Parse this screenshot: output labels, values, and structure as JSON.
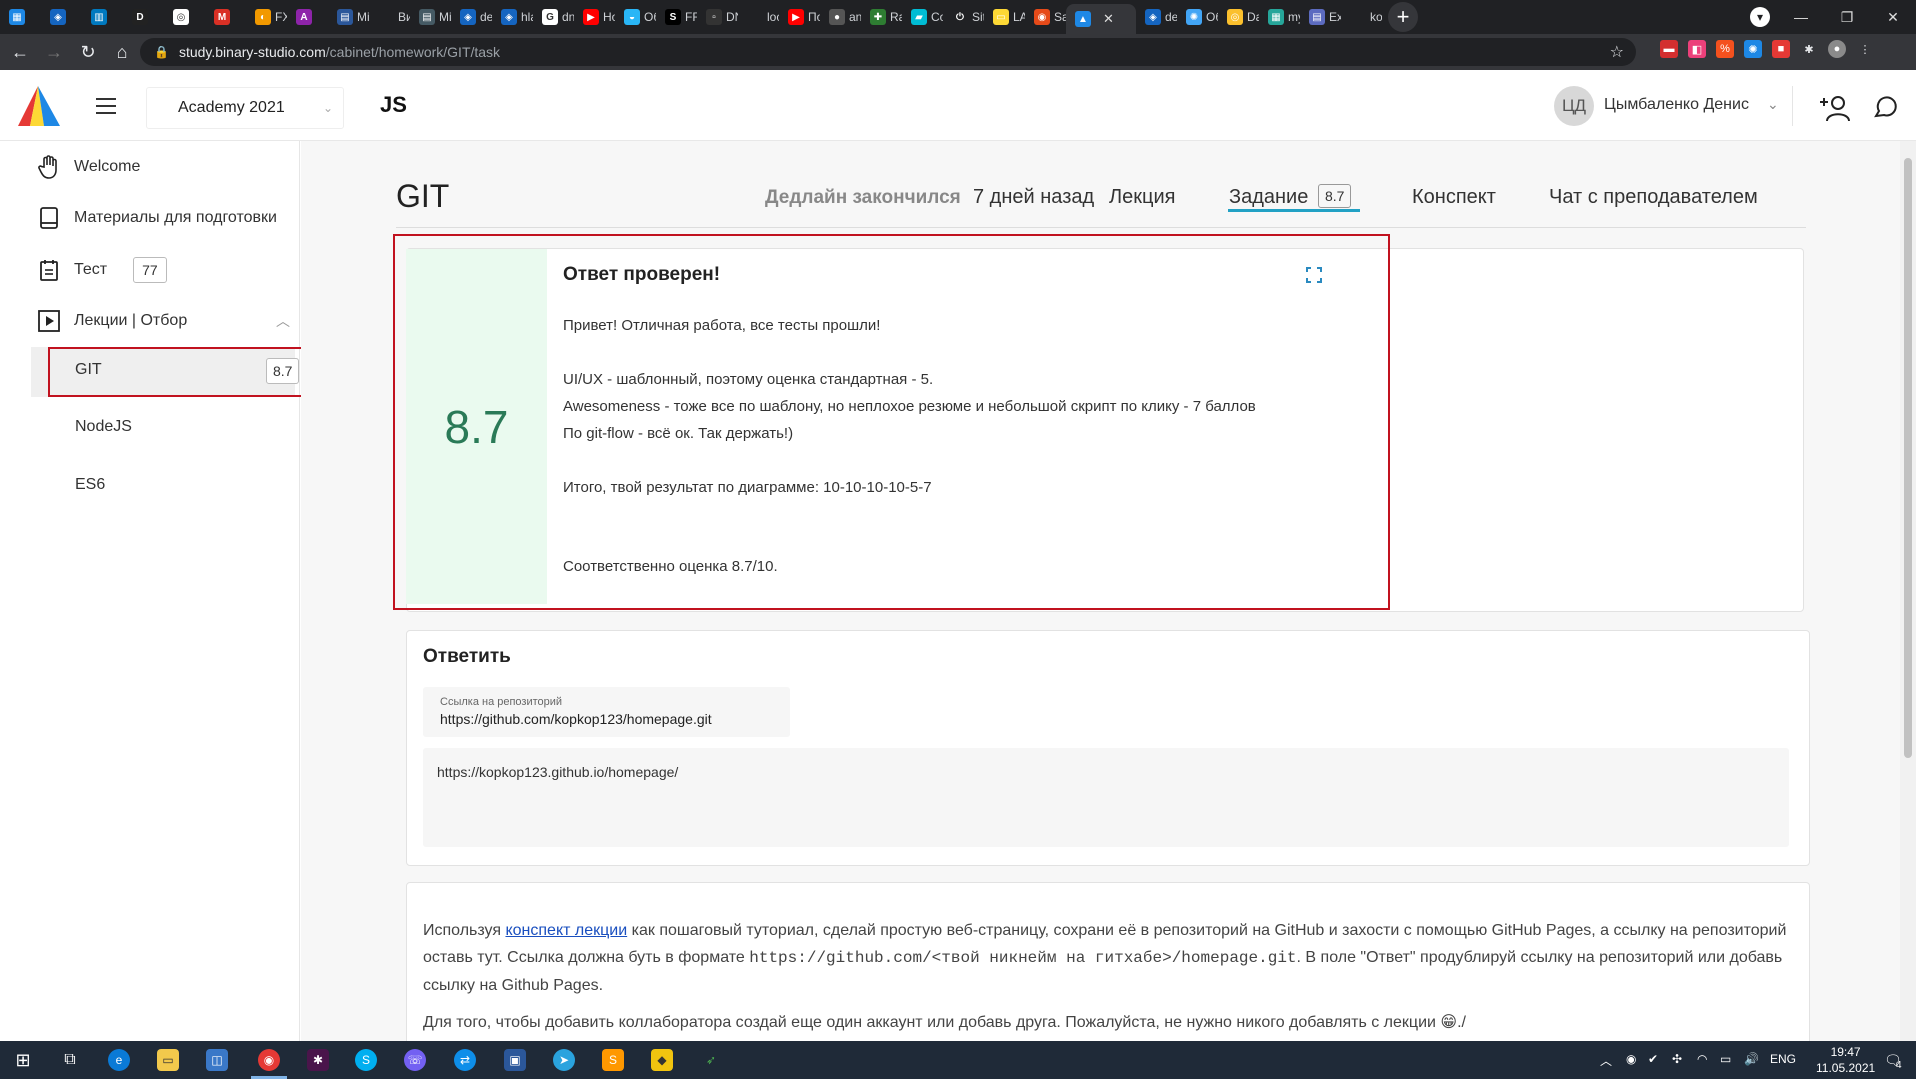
{
  "browser": {
    "tabs": [
      {
        "label": "",
        "color": "#1e88e5",
        "glyph": "▦"
      },
      {
        "label": "",
        "color": "#1565c0",
        "glyph": "◈"
      },
      {
        "label": "",
        "color": "#0079bf",
        "glyph": "▥"
      },
      {
        "label": "",
        "color": "#222222",
        "glyph": "D"
      },
      {
        "label": "",
        "color": "#ffffff",
        "glyph": "◎"
      },
      {
        "label": "",
        "color": "#d93025",
        "glyph": "M"
      },
      {
        "label": "FX",
        "color": "#f29900",
        "glyph": "◐"
      },
      {
        "label": "",
        "color": "#8e24aa",
        "glyph": "A"
      },
      {
        "label": "Mi",
        "color": "#2b579a",
        "glyph": "▤"
      },
      {
        "label": "Ви",
        "color": "#202124",
        "glyph": ""
      },
      {
        "label": "Mi",
        "color": "#455a64",
        "glyph": "▤"
      },
      {
        "label": "de",
        "color": "#1565c0",
        "glyph": "◈"
      },
      {
        "label": "hla",
        "color": "#1565c0",
        "glyph": "◈"
      },
      {
        "label": "dn",
        "color": "#ffffff",
        "glyph": "G"
      },
      {
        "label": "Ho",
        "color": "#ff0000",
        "glyph": "▶"
      },
      {
        "label": "Об",
        "color": "#29b6f6",
        "glyph": "◒"
      },
      {
        "label": "FR",
        "color": "#000000",
        "glyph": "S"
      },
      {
        "label": "DN",
        "color": "#333333",
        "glyph": "▫"
      },
      {
        "label": "loc",
        "color": "#202124",
        "glyph": ""
      },
      {
        "label": "По",
        "color": "#ff0000",
        "glyph": "▶"
      },
      {
        "label": "an",
        "color": "#555555",
        "glyph": "●"
      },
      {
        "label": "Ra",
        "color": "#2e7d32",
        "glyph": "✚"
      },
      {
        "label": "Co",
        "color": "#00bcd4",
        "glyph": "▰"
      },
      {
        "label": "Sit",
        "color": "#202124",
        "glyph": "⏻"
      },
      {
        "label": "LA",
        "color": "#fdd835",
        "glyph": "▭"
      },
      {
        "label": "Sal",
        "color": "#e64a19",
        "glyph": "◉"
      },
      {
        "label": "",
        "color": "#1e88e5",
        "glyph": "▲",
        "active": true
      },
      {
        "label": "de",
        "color": "#1565c0",
        "glyph": "◈"
      },
      {
        "label": "Об",
        "color": "#42a5f5",
        "glyph": "✺"
      },
      {
        "label": "Da",
        "color": "#fbc02d",
        "glyph": "◎"
      },
      {
        "label": "my",
        "color": "#26a69a",
        "glyph": "▦"
      },
      {
        "label": "Exi",
        "color": "#5c6bc0",
        "glyph": "▤"
      },
      {
        "label": "ko",
        "color": "#202124",
        "glyph": ""
      }
    ],
    "url_host": "study.binary-studio.com",
    "url_path": "/cabinet/homework/GIT/task"
  },
  "header": {
    "course": "Academy 2021",
    "section": "JS",
    "avatar_initials": "ЦД",
    "user_name": "Цымбаленко Денис"
  },
  "sidebar": {
    "welcome": "Welcome",
    "materials": "Материалы для подготовки",
    "test": "Тест",
    "test_badge": "77",
    "lectures": "Лекции | Отбор",
    "sub_items": [
      {
        "label": "GIT",
        "badge": "8.7"
      },
      {
        "label": "NodeJS"
      },
      {
        "label": "ES6"
      }
    ]
  },
  "main": {
    "title": "GIT",
    "deadline_label": "Дедлайн закончился",
    "deadline_when": "7 дней назад",
    "tabs": {
      "lecture": "Лекция",
      "task": "Задание",
      "task_badge": "8.7",
      "summary": "Конспект",
      "chat": "Чат с преподавателем"
    },
    "feedback": {
      "grade": "8.7",
      "title": "Ответ проверен!",
      "lines": [
        "Привет! Отличная работа, все тесты прошли!",
        "UI/UX - шаблонный, поэтому оценка стандартная - 5.",
        "Awesomeness - тоже все по шаблону, но неплохое резюме и небольшой скрипт по клику - 7 баллов",
        "По git-flow - всё ок. Так держать!)",
        "Итого, твой результат по диаграмме: 10-10-10-10-5-7",
        "Соответственно оценка 8.7/10."
      ]
    },
    "reply": {
      "title": "Ответить",
      "repo_label": "Ссылка на репозиторий",
      "repo_value": "https://github.com/kopkop123/homepage.git",
      "answer_value": "https://kopkop123.github.io/homepage/"
    },
    "task": {
      "p1_a": "Используя ",
      "p1_link": "конспект лекции",
      "p1_b": " как пошаговый туториал, сделай простую веб-страницу, сохрани её в репозиторий на GitHub и захости с помощью GitHub Pages, а ссылку на репозиторий оставь тут. Ссылка должна буть в формате ",
      "p1_code": "https://github.com/<твой никнейм на гитхабе>/homepage.git",
      "p1_c": ". В поле \"Ответ\" продублируй ссылку на репозиторий или добавь ссылку на Github Pages.",
      "p2": "Для того, чтобы добавить коллаборатора создай еще один аккаунт или добавь друга. Пожалуйста, не нужно никого добавлять с лекции 😁./"
    }
  },
  "taskbar": {
    "lang": "ENG",
    "time": "19:47",
    "date": "11.05.2021",
    "notifications": "4"
  },
  "colors": {
    "accent": "#22a1c4",
    "grade_bg": "#eafaef",
    "grade_text": "#2a7a57",
    "highlight": "#c1121f"
  }
}
